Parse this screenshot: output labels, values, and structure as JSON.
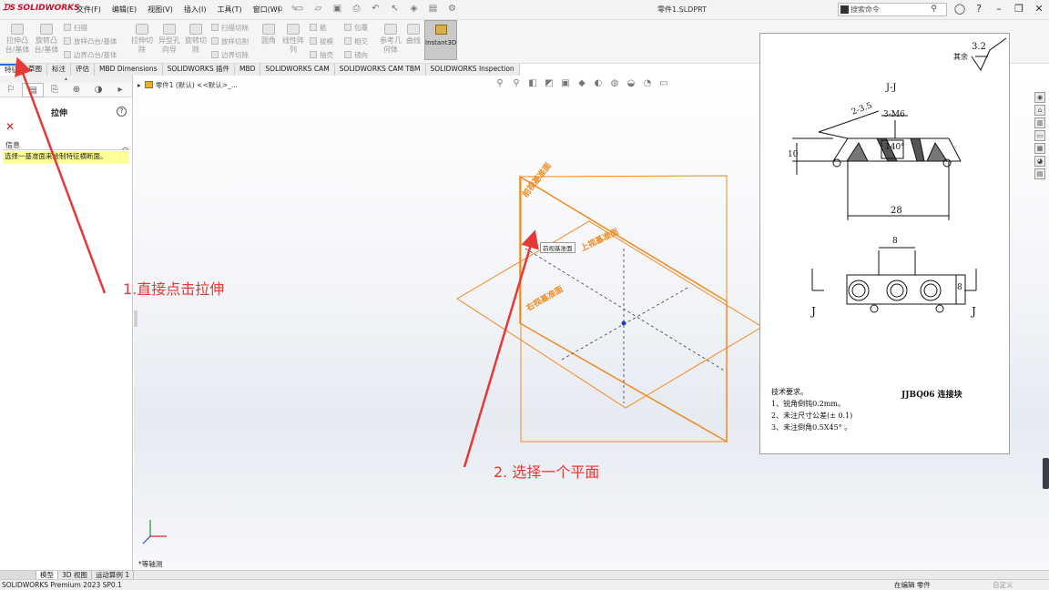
{
  "app": {
    "logo_text": "SOLIDWORKS",
    "document_title": "零件1.SLDPRT",
    "search_placeholder": "搜索命令"
  },
  "menu": [
    "文件(F)",
    "编辑(E)",
    "视图(V)",
    "插入(I)",
    "工具(T)",
    "窗口(W)"
  ],
  "ribbon": {
    "extrude_boss": "拉伸凸台/基体",
    "revolve_boss": "旋转凸台/基体",
    "sweep": "扫描",
    "loft": "放样凸台/基体",
    "boundary_boss": "边界凸台/基体",
    "extrude_cut": "拉伸切除",
    "hole_wizard": "异型孔向导",
    "revolve_cut": "旋转切除",
    "swept_cut": "扫描切除",
    "lofted_cut": "放样切割",
    "boundary_cut": "边界切除",
    "fillet": "圆角",
    "linear_pattern": "线性阵列",
    "rib": "筋",
    "draft": "拔模",
    "shell": "抽壳",
    "wrap": "包覆",
    "intersect": "相交",
    "mirror": "镜向",
    "reference_geometry": "参考几何体",
    "curves": "曲线",
    "instant3d": "Instant3D"
  },
  "tabs": [
    "特征",
    "草图",
    "标注",
    "评估",
    "MBD Dimensions",
    "SOLIDWORKS 插件",
    "MBD",
    "SOLIDWORKS CAM",
    "SOLIDWORKS CAM TBM",
    "SOLIDWORKS Inspection"
  ],
  "property_manager": {
    "title": "拉伸",
    "message_header": "信息",
    "message_body": "选择一基准面来绘制特征横断面。"
  },
  "viewport": {
    "tree_path": "零件1 (默认) <<默认>_...",
    "view_orientation": "*等轴测",
    "planes": {
      "front": "前视基准面",
      "top": "上视基准面",
      "right": "右视基准面"
    },
    "tooltip": "前视基准面"
  },
  "drawing": {
    "roughness_value": "3.2",
    "roughness_label": "其余",
    "section_label": "J-J",
    "dim_chamfer": "2-3.5",
    "dim_thread": "3-M6",
    "dim_angle": "140°",
    "dim_height": "10",
    "dim_length": "28",
    "dim_pitch": "8",
    "dim_thickness": "8",
    "cut_left": "J",
    "cut_right": "J",
    "requirements_title": "技术要求。",
    "requirements": [
      "1、锐角倒钝0.2mm。",
      "2、未注尺寸公差(± 0.1)",
      "3、未注倒角0.5X45° 。"
    ],
    "part_title": "JJBQ06 连接块"
  },
  "annotations": {
    "step1": "1.直接点击拉伸",
    "step2": "2. 选择一个平面"
  },
  "bottom_tabs": [
    "模型",
    "3D 视图",
    "运动算例 1"
  ],
  "status": {
    "left": "SOLIDWORKS Premium 2023 SP0.1",
    "editing": "在编辑 零件",
    "custom": "自定义"
  },
  "colors": {
    "plane_orange": "#f08a1e",
    "annotation_red": "#e53935",
    "brand_red": "#c8102e"
  }
}
